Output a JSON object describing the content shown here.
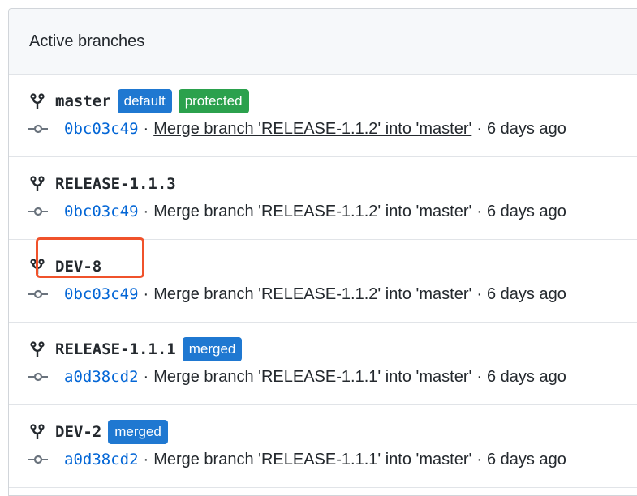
{
  "panel": {
    "title": "Active branches"
  },
  "branches": [
    {
      "name": "master",
      "labels": [
        {
          "text": "default",
          "color": "#1f78d1"
        },
        {
          "text": "protected",
          "color": "#2ba14d"
        }
      ],
      "sha": "0bc03c49",
      "message": "Merge branch 'RELEASE-1.1.2' into 'master'",
      "time": "6 days ago"
    },
    {
      "name": "RELEASE-1.1.3",
      "labels": [],
      "sha": "0bc03c49",
      "message": "Merge branch 'RELEASE-1.1.2' into 'master'",
      "time": "6 days ago"
    },
    {
      "name": "DEV-8",
      "labels": [],
      "sha": "0bc03c49",
      "message": "Merge branch 'RELEASE-1.1.2' into 'master'",
      "time": "6 days ago"
    },
    {
      "name": "RELEASE-1.1.1",
      "labels": [
        {
          "text": "merged",
          "color": "#1f78d1"
        }
      ],
      "sha": "a0d38cd2",
      "message": "Merge branch 'RELEASE-1.1.1' into 'master'",
      "time": "6 days ago"
    },
    {
      "name": "DEV-2",
      "labels": [
        {
          "text": "merged",
          "color": "#1f78d1"
        }
      ],
      "sha": "a0d38cd2",
      "message": "Merge branch 'RELEASE-1.1.1' into 'master'",
      "time": "6 days ago"
    }
  ],
  "separator": "·",
  "icons": {
    "branch": "git-branch-icon",
    "commit": "git-commit-icon"
  },
  "colors": {
    "link": "#0366d6",
    "highlight": "#f0522b"
  }
}
